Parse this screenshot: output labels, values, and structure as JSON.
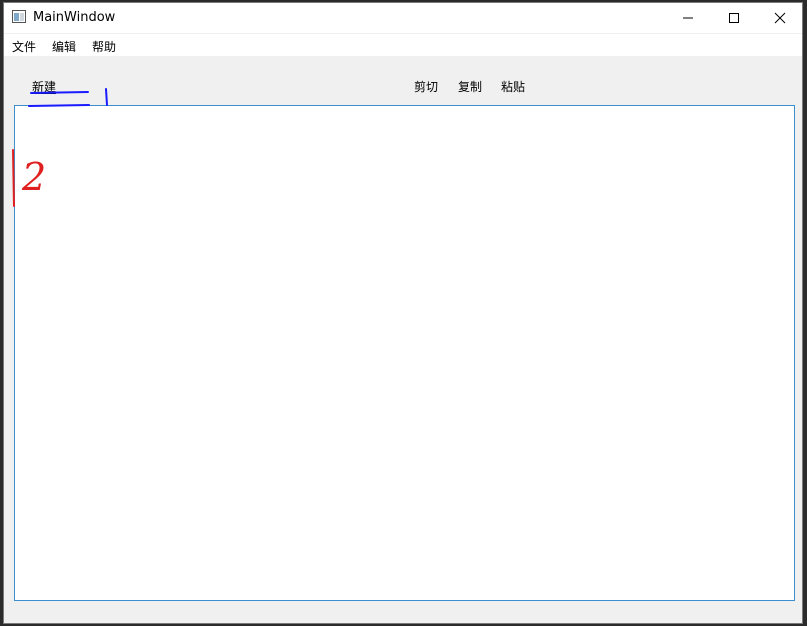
{
  "window": {
    "title": "MainWindow"
  },
  "menubar": {
    "items": [
      "文件",
      "编辑",
      "帮助"
    ]
  },
  "toolbar": {
    "new_label": "新建",
    "cut_label": "剪切",
    "copy_label": "复制",
    "paste_label": "粘贴"
  },
  "annotation": {
    "handwritten_number": "2"
  },
  "colors": {
    "accent_border": "#3c8fcf",
    "annotation_blue": "#1a1aff",
    "annotation_red": "#e02020"
  }
}
